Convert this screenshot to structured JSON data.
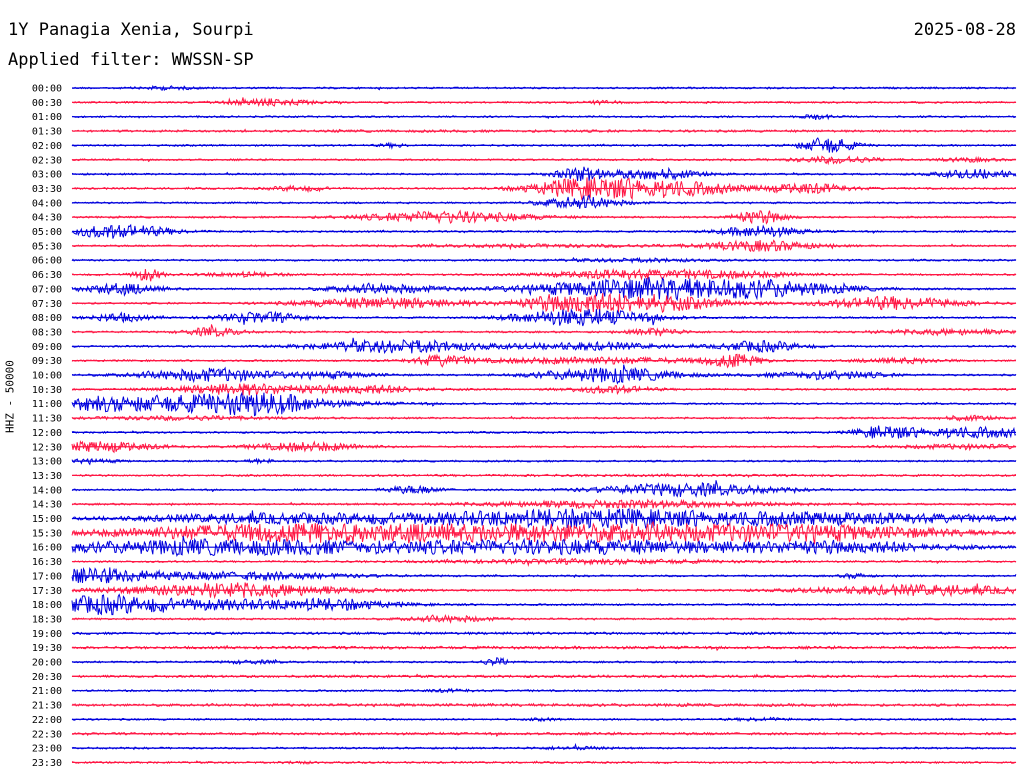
{
  "header": {
    "station": "1Y Panagia Xenia, Sourpi",
    "date": "2025-08-28",
    "filter": "Applied filter: WWSSN-SP"
  },
  "chart_data": {
    "type": "line",
    "title": "1Y Panagia Xenia, Sourpi",
    "ylabel": "HHZ - 50000",
    "rows": [
      "00:00",
      "00:30",
      "01:00",
      "01:30",
      "02:00",
      "02:30",
      "03:00",
      "03:30",
      "04:00",
      "04:30",
      "05:00",
      "05:30",
      "06:00",
      "06:30",
      "07:00",
      "07:30",
      "08:00",
      "08:30",
      "09:00",
      "09:30",
      "10:00",
      "10:30",
      "11:00",
      "11:30",
      "12:00",
      "12:30",
      "13:00",
      "13:30",
      "14:00",
      "14:30",
      "15:00",
      "15:30",
      "16:00",
      "16:30",
      "17:00",
      "17:30",
      "18:00",
      "18:30",
      "19:00",
      "19:30",
      "20:00",
      "20:30",
      "21:00",
      "21:30",
      "22:00",
      "22:30",
      "23:00",
      "23:30"
    ],
    "colors": {
      "even": "#0000dd",
      "odd": "#ff1744"
    },
    "rows_activity": [
      [
        [
          0.1,
          0.02,
          0.4
        ]
      ],
      [
        [
          0.21,
          0.03,
          0.9
        ],
        [
          0.56,
          0.02,
          0.3
        ]
      ],
      [
        [
          0.79,
          0.01,
          0.6
        ]
      ],
      [
        [
          0.5,
          0.3,
          0.1
        ]
      ],
      [
        [
          0.34,
          0.01,
          0.5
        ],
        [
          0.8,
          0.02,
          2.2
        ]
      ],
      [
        [
          0.81,
          0.03,
          0.9
        ],
        [
          0.95,
          0.02,
          0.5
        ]
      ],
      [
        [
          0.54,
          0.02,
          1.8
        ],
        [
          0.62,
          0.03,
          1.5
        ],
        [
          0.96,
          0.03,
          1.2
        ]
      ],
      [
        [
          0.54,
          0.04,
          2.5
        ],
        [
          0.63,
          0.05,
          2.2
        ],
        [
          0.78,
          0.03,
          1.4
        ],
        [
          0.24,
          0.02,
          0.7
        ]
      ],
      [
        [
          0.54,
          0.03,
          1.6
        ]
      ],
      [
        [
          0.4,
          0.06,
          1.6
        ],
        [
          0.73,
          0.02,
          1.8
        ]
      ],
      [
        [
          0.05,
          0.04,
          1.8
        ],
        [
          0.73,
          0.03,
          1.5
        ]
      ],
      [
        [
          0.73,
          0.04,
          1.4
        ],
        [
          0.5,
          0.1,
          0.3
        ]
      ],
      [
        [
          0.6,
          0.05,
          0.4
        ]
      ],
      [
        [
          0.08,
          0.01,
          1.8
        ],
        [
          0.18,
          0.03,
          0.6
        ],
        [
          0.58,
          0.05,
          1.2
        ],
        [
          0.7,
          0.05,
          0.9
        ]
      ],
      [
        [
          0.05,
          0.03,
          1.4
        ],
        [
          0.33,
          0.04,
          1.2
        ],
        [
          0.6,
          0.08,
          2.8
        ],
        [
          0.74,
          0.06,
          1.8
        ]
      ],
      [
        [
          0.33,
          0.06,
          1.5
        ],
        [
          0.52,
          0.03,
          1.8
        ],
        [
          0.6,
          0.06,
          2.5
        ],
        [
          0.87,
          0.05,
          1.8
        ]
      ],
      [
        [
          0.05,
          0.02,
          1.2
        ],
        [
          0.2,
          0.03,
          1.5
        ],
        [
          0.52,
          0.04,
          1.8
        ],
        [
          0.58,
          0.04,
          1.2
        ]
      ],
      [
        [
          0.15,
          0.02,
          1.2
        ],
        [
          0.62,
          0.02,
          1.0
        ],
        [
          0.93,
          0.05,
          0.7
        ]
      ],
      [
        [
          0.35,
          0.06,
          1.8
        ],
        [
          0.55,
          0.05,
          1.0
        ],
        [
          0.73,
          0.03,
          1.5
        ]
      ],
      [
        [
          0.39,
          0.02,
          1.4
        ],
        [
          0.55,
          0.08,
          0.9
        ],
        [
          0.7,
          0.02,
          1.8
        ],
        [
          0.88,
          0.03,
          0.7
        ]
      ],
      [
        [
          0.15,
          0.05,
          1.8
        ],
        [
          0.28,
          0.03,
          0.8
        ],
        [
          0.57,
          0.05,
          2.0
        ],
        [
          0.8,
          0.04,
          1.2
        ]
      ],
      [
        [
          0.18,
          0.05,
          1.5
        ],
        [
          0.31,
          0.04,
          1.2
        ],
        [
          0.57,
          0.03,
          1.0
        ]
      ],
      [
        [
          0.08,
          0.12,
          2.2
        ],
        [
          0.2,
          0.04,
          2.0
        ]
      ],
      [
        [
          0.12,
          0.06,
          0.5
        ],
        [
          0.95,
          0.02,
          0.6
        ]
      ],
      [
        [
          0.86,
          0.02,
          1.6
        ],
        [
          0.95,
          0.05,
          1.4
        ]
      ],
      [
        [
          0.03,
          0.04,
          1.4
        ],
        [
          0.25,
          0.04,
          1.2
        ],
        [
          0.95,
          0.05,
          0.6
        ]
      ],
      [
        [
          0.02,
          0.02,
          0.5
        ],
        [
          0.2,
          0.01,
          0.5
        ]
      ],
      [
        [
          0.6,
          0.2,
          0.1
        ]
      ],
      [
        [
          0.36,
          0.02,
          1.0
        ],
        [
          0.65,
          0.06,
          1.8
        ]
      ],
      [
        [
          0.58,
          0.1,
          1.0
        ]
      ],
      [
        [
          0.2,
          0.1,
          1.2
        ],
        [
          0.55,
          0.15,
          2.6
        ],
        [
          0.85,
          0.1,
          1.2
        ]
      ],
      [
        [
          0.2,
          0.12,
          2.0
        ],
        [
          0.52,
          0.18,
          2.4
        ],
        [
          0.8,
          0.1,
          1.6
        ]
      ],
      [
        [
          0.13,
          0.12,
          1.8
        ],
        [
          0.52,
          0.2,
          2.0
        ],
        [
          0.83,
          0.06,
          1.2
        ]
      ],
      [
        [
          0.55,
          0.1,
          0.6
        ]
      ],
      [
        [
          0.02,
          0.05,
          1.8
        ],
        [
          0.18,
          0.08,
          1.0
        ],
        [
          0.83,
          0.01,
          0.6
        ]
      ],
      [
        [
          0.17,
          0.08,
          2.0
        ],
        [
          0.9,
          0.08,
          1.4
        ]
      ],
      [
        [
          0.03,
          0.04,
          2.0
        ],
        [
          0.15,
          0.1,
          1.4
        ],
        [
          0.28,
          0.04,
          1.0
        ]
      ],
      [
        [
          0.4,
          0.03,
          0.8
        ]
      ],
      [
        [
          0.5,
          0.4,
          0.1
        ]
      ],
      [
        [
          0.5,
          0.4,
          0.15
        ]
      ],
      [
        [
          0.19,
          0.02,
          0.4
        ],
        [
          0.45,
          0.01,
          1.0
        ]
      ],
      [
        [
          0.5,
          0.4,
          0.1
        ]
      ],
      [
        [
          0.4,
          0.02,
          0.3
        ]
      ],
      [
        [
          0.5,
          0.4,
          0.15
        ]
      ],
      [
        [
          0.5,
          0.01,
          0.3
        ],
        [
          0.73,
          0.02,
          0.4
        ]
      ],
      [
        [
          0.5,
          0.4,
          0.1
        ]
      ],
      [
        [
          0.53,
          0.03,
          0.3
        ]
      ],
      [
        [
          0.24,
          0.01,
          0.3
        ]
      ]
    ]
  }
}
